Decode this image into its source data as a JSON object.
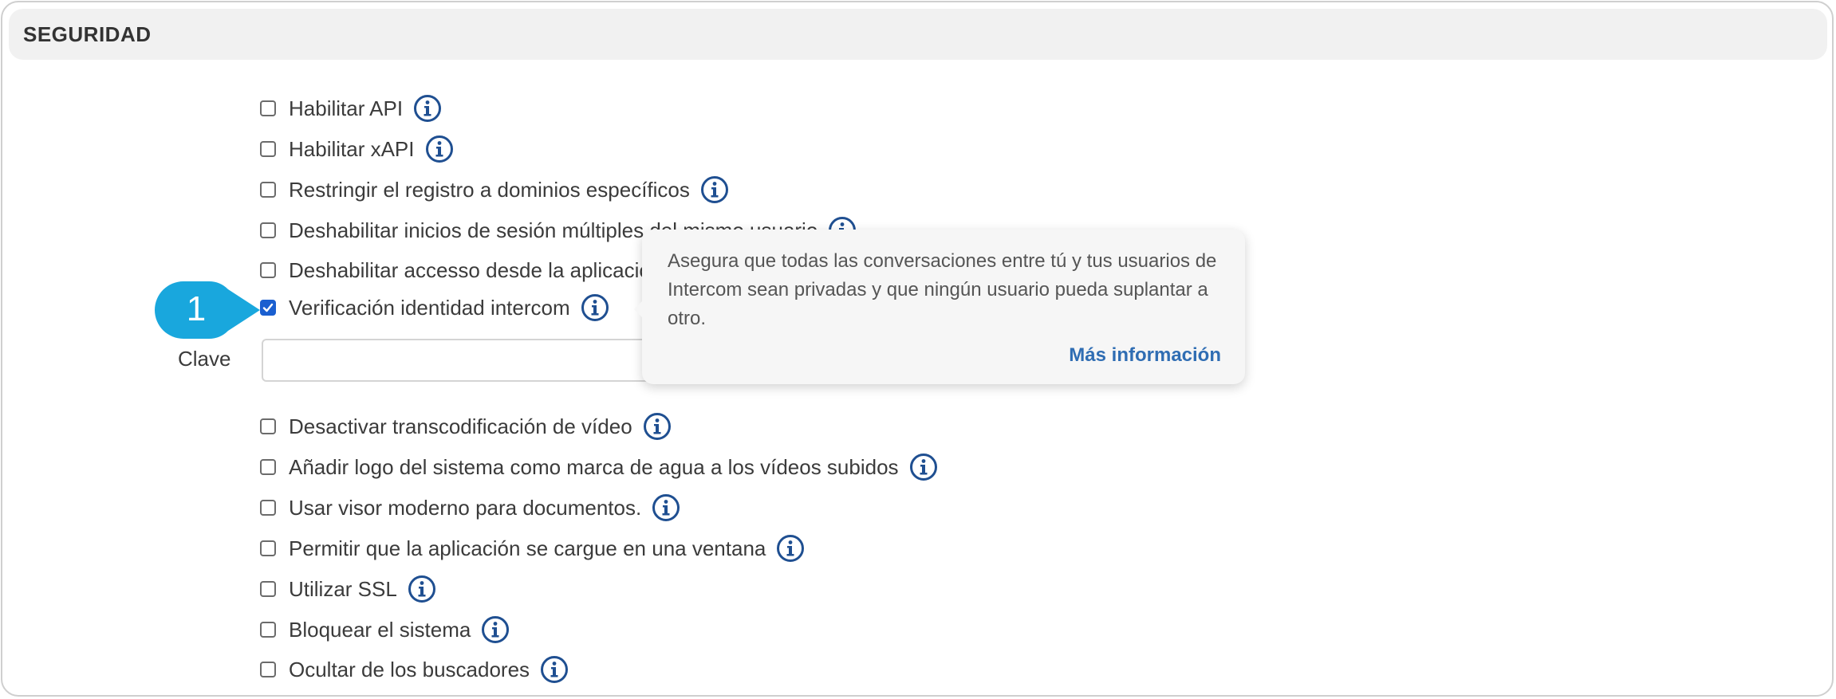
{
  "section": {
    "title": "SEGURIDAD"
  },
  "options": [
    {
      "label": "Habilitar API",
      "checked": false
    },
    {
      "label": "Habilitar xAPI",
      "checked": false
    },
    {
      "label": "Restringir el registro a dominios específicos",
      "checked": false
    },
    {
      "label": "Deshabilitar inicios de sesión múltiples del mismo usuario",
      "checked": false
    },
    {
      "label": "Deshabilitar accesso desde la aplicación",
      "checked": false
    },
    {
      "label": "Verificación identidad intercom",
      "checked": true
    },
    {
      "label": "Desactivar transcodificación de vídeo",
      "checked": false
    },
    {
      "label": "Añadir logo del sistema como marca de agua a los vídeos subidos",
      "checked": false
    },
    {
      "label": "Usar visor moderno para documentos.",
      "checked": false
    },
    {
      "label": "Permitir que la aplicación se cargue en una ventana",
      "checked": false
    },
    {
      "label": "Utilizar SSL",
      "checked": false
    },
    {
      "label": "Bloquear el sistema",
      "checked": false
    },
    {
      "label": "Ocultar de los buscadores",
      "checked": false
    }
  ],
  "clave": {
    "label": "Clave",
    "value": "",
    "placeholder": ""
  },
  "tooltip": {
    "text": "Asegura que todas las conversaciones entre tú y tus usuarios de Intercom sean privadas y que ningún usuario pueda suplantar a otro.",
    "link": "Más información"
  },
  "callout": {
    "number": "1"
  },
  "colors": {
    "accent": "#1a5fd0",
    "info_icon": "#1f4f91",
    "callout": "#19a7dd",
    "link": "#2f6db3"
  },
  "icons": {
    "info": "info-circle-icon",
    "check": "checkmark-icon"
  }
}
